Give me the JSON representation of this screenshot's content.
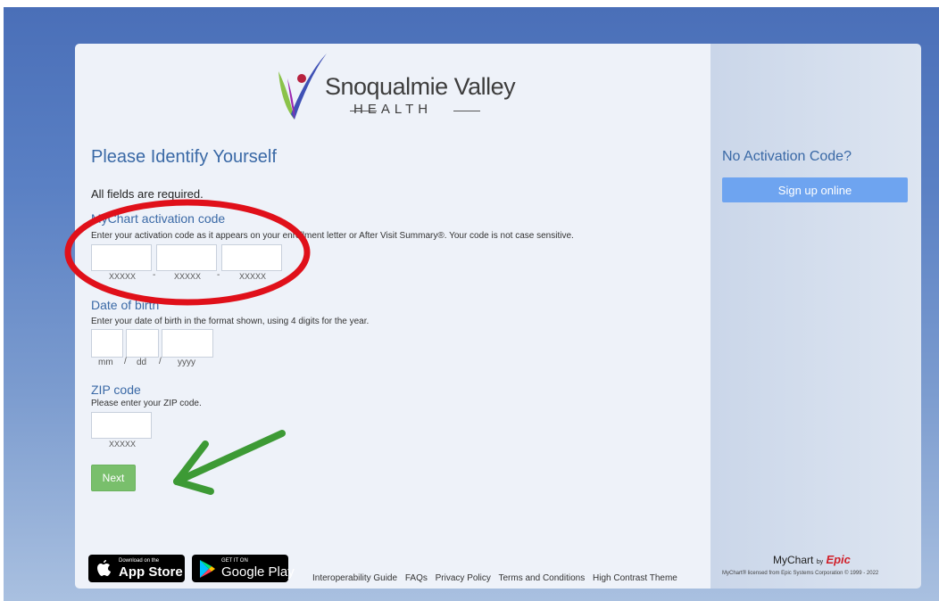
{
  "brand": {
    "name": "Snoqualmie Valley",
    "subtitle": "HEALTH"
  },
  "form": {
    "title": "Please Identify Yourself",
    "required_note": "All fields are required.",
    "activation": {
      "label": "MyChart activation code",
      "help": "Enter your activation code as it appears on your enrollment letter or After Visit Summary®. Your code is not case sensitive.",
      "hints": [
        "XXXXX",
        "XXXXX",
        "XXXXX"
      ],
      "separator": "-"
    },
    "dob": {
      "label": "Date of birth",
      "help": "Enter your date of birth in the format shown, using 4 digits for the year.",
      "hints": [
        "mm",
        "dd",
        "yyyy"
      ],
      "separator": "/"
    },
    "zip": {
      "label": "ZIP code",
      "help": "Please enter your ZIP code.",
      "hint": "XXXXX"
    },
    "next_label": "Next"
  },
  "stores": {
    "apple_small": "Download on the",
    "apple_big": "App Store",
    "google_small": "GET IT ON",
    "google_big": "Google Play"
  },
  "footer_links": [
    "Interoperability Guide",
    "FAQs",
    "Privacy Policy",
    "Terms and Conditions",
    "High Contrast Theme"
  ],
  "sidebar": {
    "heading": "No Activation Code?",
    "signup_label": "Sign up online",
    "mychart": "MyChart",
    "by": "by",
    "epic": "Epic",
    "copyright": "MyChart® licensed from Epic Systems Corporation © 1999 - 2022"
  },
  "colors": {
    "accent": "#3a69a6",
    "next_button": "#79bf6c",
    "signup_button": "#6ea4f0",
    "annotation_circle": "#e0101a",
    "annotation_arrow": "#3d9a35"
  }
}
